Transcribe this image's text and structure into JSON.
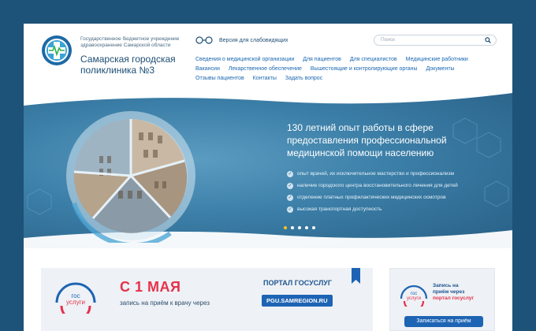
{
  "header": {
    "org_line1": "Государственное бюджетное учреждение",
    "org_line2": "здравоохранение Самарской области",
    "title_line1": "Самарская городская",
    "title_line2": "поликлиника №3",
    "vision_label": "Версия для слабовидящих",
    "search_placeholder": "Поиск"
  },
  "nav": {
    "items": [
      "Сведения о медицинской организации",
      "Для пациентов",
      "Для специалистов",
      "Медицинские работники",
      "Вакансии",
      "Лекарственное обеспечение",
      "Вышестоящие и контролирующие органы",
      "Документы",
      "Отзывы пациентов",
      "Контакты",
      "Задать вопрос"
    ]
  },
  "hero": {
    "title": "130 летний опыт работы в сфере предоставления профессиональной медицинской помощи населению",
    "bullets": [
      "опыт врачей, их исключительное мастерство и профессионализм",
      "наличие городского центра восстановительного лечения для детей",
      "отделение платных профилактических медицинских осмотров",
      "высокая транспортная доступность"
    ],
    "slides_total": 5,
    "slide_active": 1
  },
  "banner_main": {
    "gos_logo_line1": "гос",
    "gos_logo_line2": "услуги",
    "headline": "С 1 МАЯ",
    "subtitle": "запись на приём к врачу через",
    "portal_label": "ПОРТАЛ ГОСУСЛУГ",
    "portal_url": "PGU.SAMREGION.RU"
  },
  "banner_side": {
    "gos_logo_line1": "гос",
    "gos_logo_line2": "услуги",
    "text_line1": "Запись на",
    "text_line2": "приём через",
    "text_line3": "портал госуслуг",
    "button_label": "Записаться на приём"
  },
  "colors": {
    "background": "#1d5279",
    "accent_red": "#e5314c",
    "accent_blue": "#1d64b4",
    "link_blue": "#1a67b0"
  }
}
